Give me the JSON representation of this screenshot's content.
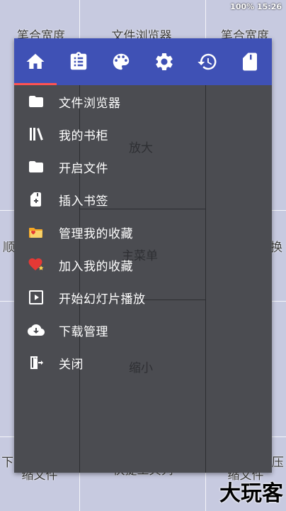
{
  "status_bar": {
    "text": "100% 15:26"
  },
  "zones": {
    "top_left": "笔合宽度",
    "top_center": "文件浏览器",
    "top_right": "笔合宽度",
    "zoom_in": "放大",
    "mid_left": "顺向滚动并换页",
    "main_menu": "主菜单",
    "mid_right": "逆向滚动并换页",
    "zoom_out": "缩小",
    "bottom_left": "下个文件夹/压缩文件",
    "bottom_center": "快捷工具列",
    "bottom_right": "上个文件夹/压缩文件"
  },
  "toolbar": {
    "icons": [
      "home-icon",
      "clipboard-list-icon",
      "palette-icon",
      "gear-icon",
      "history-icon",
      "bookmark-page-icon"
    ],
    "active_index": 0,
    "accent_color": "#3f51b5",
    "indicator_color": "#ff5252"
  },
  "menu": {
    "items": [
      {
        "label": "文件浏览器",
        "icon": "folder-icon"
      },
      {
        "label": "我的书柜",
        "icon": "bookshelf-icon"
      },
      {
        "label": "开启文件",
        "icon": "folder-open-icon"
      },
      {
        "label": "插入书签",
        "icon": "bookmark-add-icon"
      },
      {
        "label": "管理我的收藏",
        "icon": "favorites-folder-icon"
      },
      {
        "label": "加入我的收藏",
        "icon": "heart-star-icon"
      },
      {
        "label": "开始幻灯片播放",
        "icon": "slideshow-play-icon"
      },
      {
        "label": "下载管理",
        "icon": "cloud-download-icon"
      },
      {
        "label": "关闭",
        "icon": "exit-door-icon"
      }
    ]
  },
  "watermark": "大玩客"
}
